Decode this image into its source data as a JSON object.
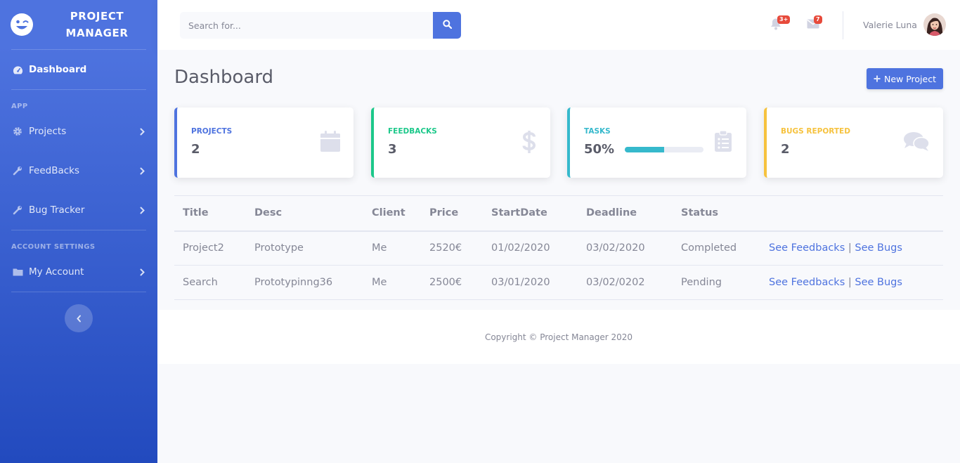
{
  "brand": {
    "line1": "PROJECT",
    "line2": "MANAGER",
    "icon": "laugh-wink-icon"
  },
  "sidebar": {
    "dashboard": {
      "label": "Dashboard",
      "icon": "tachometer-icon"
    },
    "heading_app": "APP",
    "items": [
      {
        "label": "Projects",
        "icon": "cog-icon"
      },
      {
        "label": "FeedBacks",
        "icon": "wrench-icon"
      },
      {
        "label": "Bug Tracker",
        "icon": "wrench-icon"
      }
    ],
    "heading_account": "ACCOUNT SETTINGS",
    "account": {
      "label": "My Account",
      "icon": "folder-icon"
    },
    "toggle_icon": "chevron-left-icon"
  },
  "topbar": {
    "search_placeholder": "Search for...",
    "alerts_badge": "3+",
    "messages_badge": "7",
    "user_name": "Valerie Luna"
  },
  "page": {
    "title": "Dashboard",
    "new_project_label": "New Project"
  },
  "cards": [
    {
      "label": "Projects",
      "value": "2",
      "color": "#4e73df",
      "icon": "calendar-icon"
    },
    {
      "label": "Feedbacks",
      "value": "3",
      "color": "#1cc88a",
      "icon": "dollar-icon"
    },
    {
      "label": "Tasks",
      "value": "50%",
      "progress": 0.5,
      "color": "#36b9cc",
      "icon": "clipboard-list-icon"
    },
    {
      "label": "Bugs Reported",
      "value": "2",
      "color": "#f6c23e",
      "icon": "comments-icon"
    }
  ],
  "table": {
    "headers": [
      "Title",
      "Desc",
      "Client",
      "Price",
      "StartDate",
      "Deadline",
      "Status"
    ],
    "rows": [
      {
        "title": "Project2",
        "desc": "Prototype",
        "client": "Me",
        "price": "2520€",
        "start": "01/02/2020",
        "deadline": "03/02/2020",
        "status": "Completed",
        "link1": "See Feedbacks",
        "sep": "|",
        "link2": "See Bugs"
      },
      {
        "title": "Search",
        "desc": "Prototypinng36",
        "client": "Me",
        "price": "2500€",
        "start": "03/01/2020",
        "deadline": "03/02/0202",
        "status": "Pending",
        "link1": "See Feedbacks",
        "sep": "|",
        "link2": "See Bugs"
      }
    ]
  },
  "footer": {
    "text": "Copyright © Project Manager 2020"
  }
}
